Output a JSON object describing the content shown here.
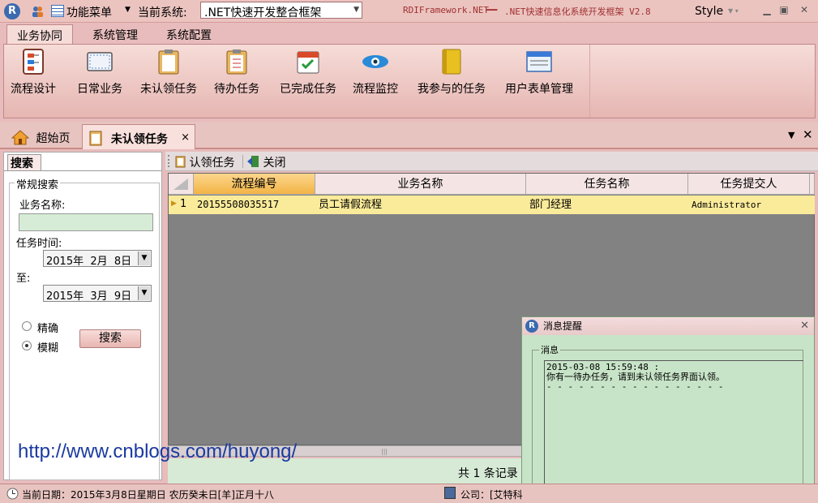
{
  "titlebar": {
    "function_menu": "功能菜单",
    "current_system_label": "当前系统:",
    "current_system_value": ".NET快速开发整合框架",
    "app_title_left": "RDIFramework.NET",
    "app_title_sep": "━━",
    "app_title_right": ".NET快速信息化系统开发框架 V2.8",
    "style_label": "Style"
  },
  "ribbon": {
    "tabs": [
      "业务协同",
      "系统管理",
      "系统配置"
    ],
    "buttons": [
      "流程设计",
      "日常业务",
      "未认领任务",
      "待办任务",
      "已完成任务",
      "流程监控",
      "我参与的任务",
      "用户表单管理"
    ]
  },
  "doc_tabs": {
    "home": "超始页",
    "active": "未认领任务",
    "close": "×"
  },
  "left_panel": {
    "tab": "搜索",
    "group_title": "常规搜索",
    "business_name_label": "业务名称:",
    "business_name_value": "",
    "task_time_label": "任务时间:",
    "date_from": "2015年  2月  8日",
    "to_label": "至:",
    "date_to": "2015年  3月  9日",
    "radio_exact": "精确",
    "radio_fuzzy": "模糊",
    "search_button": "搜索"
  },
  "toolbar": {
    "claim_label": "认领任务",
    "close_label": "关闭"
  },
  "grid": {
    "columns": [
      "流程编号",
      "业务名称",
      "任务名称",
      "任务提交人"
    ],
    "rows": [
      {
        "index": "1",
        "process_no": "20155508035517",
        "business": "员工请假流程",
        "task": "部门经理",
        "submitter": "Administrator"
      }
    ],
    "record_count": "共 1 条记录"
  },
  "watermark": "http://www.cnblogs.com/huyong/",
  "popup": {
    "title": "消息提醒",
    "group_title": "消息",
    "timestamp": "2015-03-08 15:59:48 :",
    "message": "你有一待办任务，请到未认领任务界面认领。",
    "dashes": "- - - - - - - - - - - - - - - - -"
  },
  "statusbar": {
    "date_text": "当前日期：2015年3月8日星期日  农历癸未日[羊]正月十八",
    "company_text": "公司：[艾特科"
  },
  "colors": {
    "ribbon_bg": "#f6dcd8",
    "grid_bg": "#828282",
    "selected_row": "#faeb9a",
    "popup_bg": "#c8e4c8"
  }
}
